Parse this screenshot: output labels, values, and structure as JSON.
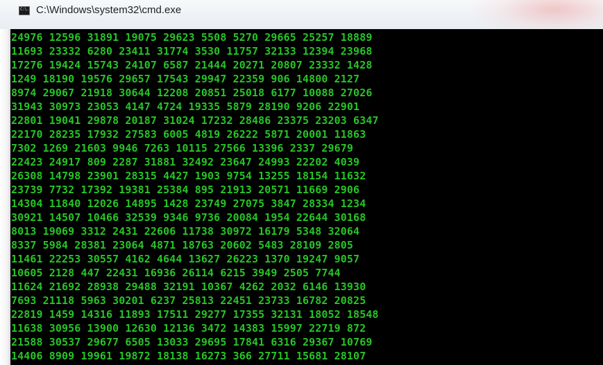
{
  "window": {
    "title": "C:\\Windows\\system32\\cmd.exe",
    "icon": "cmd-icon",
    "icon_text": "C:\\."
  },
  "console": {
    "text_color": "#27c427",
    "background": "#000000",
    "lines": [
      "24976 12596 31891 19075 29623 5508 5270 29665 25257 18889",
      "11693 23332 6280 23411 31774 3530 11757 32133 12394 23968",
      "17276 19424 15743 24107 6587 21444 20271 20807 23332 1428",
      "1249 18190 19576 29657 17543 29947 22359 906 14800 2127",
      "8974 29067 21918 30644 12208 20851 25018 6177 10088 27026",
      "31943 30973 23053 4147 4724 19335 5879 28190 9206 22901",
      "22801 19041 29878 20187 31024 17232 28486 23375 23203 6347",
      "22170 28235 17932 27583 6005 4819 26222 5871 20001 11863",
      "7302 1269 21603 9946 7263 10115 27566 13396 2337 29679",
      "22423 24917 809 2287 31881 32492 23647 24993 22202 4039",
      "26308 14798 23901 28315 4427 1903 9754 13255 18154 11632",
      "23739 7732 17392 19381 25384 895 21913 20571 11669 2906",
      "14304 11840 12026 14895 1428 23749 27075 3847 28334 1234",
      "30921 14507 10466 32539 9346 9736 20084 1954 22644 30168",
      "8013 19069 3312 2431 22606 11738 30972 16179 5348 32064",
      "8337 5984 28381 23064 4871 18763 20602 5483 28109 2805",
      "11461 22253 30557 4162 4644 13627 26223 1370 19247 9057",
      "10605 2128 447 22431 16936 26114 6215 3949 2505 7744",
      "11624 21692 28938 29488 32191 10367 4262 2032 6146 13930",
      "7693 21118 5963 30201 6237 25813 22451 23733 16782 20825",
      "22819 1459 14316 11893 17511 29277 17355 32131 18052 18548",
      "11638 30956 13900 12630 12136 3472 14383 15997 22719 872",
      "21588 30537 29677 6505 13033 29695 17841 6316 29367 10769",
      "14406 8909 19961 19872 18138 16273 366 27711 15681 28107"
    ]
  }
}
